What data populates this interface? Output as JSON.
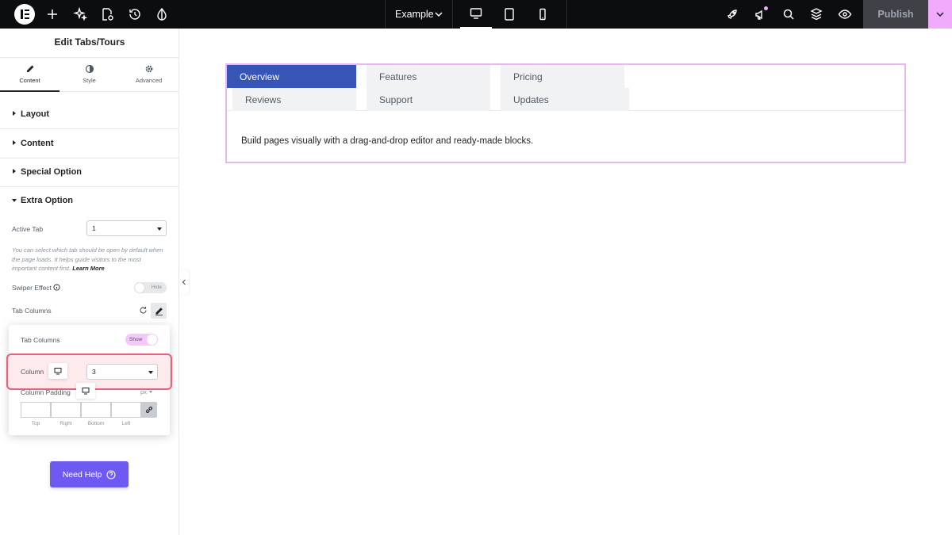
{
  "topbar": {
    "site_name": "Example",
    "publish_label": "Publish",
    "icons": [
      "elementor-logo-icon",
      "add-icon",
      "ai-sparkle-icon",
      "page-settings-icon",
      "history-icon",
      "site-settings-icon",
      "chevron-down-icon",
      "desktop-icon",
      "tablet-icon",
      "mobile-icon",
      "rocket-icon",
      "announcements-icon",
      "search-icon",
      "structure-icon",
      "preview-icon"
    ]
  },
  "panel": {
    "title": "Edit Tabs/Tours",
    "tabs": [
      {
        "label": "Content",
        "icon": "pencil-icon"
      },
      {
        "label": "Style",
        "icon": "half-circle-icon"
      },
      {
        "label": "Advanced",
        "icon": "gear-icon"
      }
    ],
    "sections": {
      "layout": "Layout",
      "content": "Content",
      "special": "Special Option",
      "extra": "Extra Option"
    },
    "active_tab_label": "Active Tab",
    "active_tab_value": "1",
    "help_text": "You can select which tab should be open by default when the page loads. It helps guide visitors to the most important content first. ",
    "help_link": "Learn More",
    "swiper_label": "Swiper Effect",
    "swiper_toggle": "Hide",
    "tab_columns_label": "Tab Columns",
    "popover": {
      "tab_columns_label": "Tab Columns",
      "tab_columns_toggle": "Show",
      "column_label": "Column",
      "column_value": "3",
      "column_padding_label": "Column Padding",
      "unit": "px",
      "padding_captions": [
        "Top",
        "Right",
        "Bottom",
        "Left"
      ]
    },
    "need_help": "Need Help"
  },
  "canvas": {
    "tabs": [
      {
        "label": "Overview",
        "active": true
      },
      {
        "label": "Features",
        "active": false
      },
      {
        "label": "Pricing",
        "active": false
      },
      {
        "label": "Reviews",
        "active": false
      },
      {
        "label": "Support",
        "active": false
      },
      {
        "label": "Updates",
        "active": false
      }
    ],
    "content_text": "Build pages visually with a drag-and-drop editor and ready-made blocks."
  },
  "colors": {
    "topbar_bg": "#0c0d0e",
    "active_tab": "#3655b5",
    "accent_pink": "#f0abfc",
    "highlight_red": "#e8607a",
    "help_button": "#6e5af0"
  }
}
